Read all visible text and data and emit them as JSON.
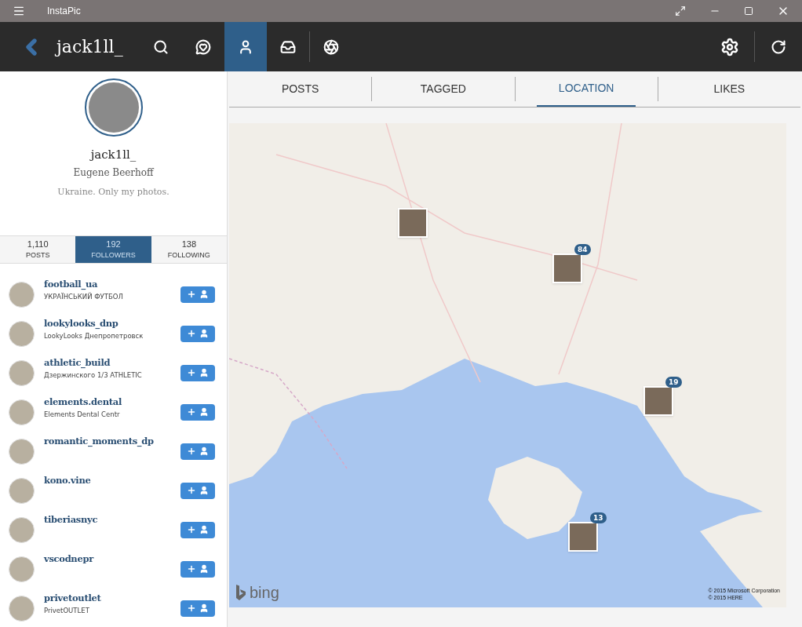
{
  "window": {
    "title": "InstaPic"
  },
  "toolbar": {
    "username": "jack1ll_",
    "nav_items": [
      {
        "kind": "search",
        "selected": false
      },
      {
        "kind": "activity",
        "selected": false
      },
      {
        "kind": "profile",
        "selected": true
      },
      {
        "kind": "inbox",
        "selected": false
      },
      {
        "kind": "camera",
        "selected": false
      }
    ]
  },
  "profile": {
    "username": "jack1ll_",
    "full_name": "Eugene Beerhoff",
    "bio": "Ukraine. Only my photos."
  },
  "stats": [
    {
      "value": "1,110",
      "label": "POSTS",
      "selected": false
    },
    {
      "value": "192",
      "label": "FOLLOWERS",
      "selected": true
    },
    {
      "value": "138",
      "label": "FOLLOWING",
      "selected": false
    }
  ],
  "followers": [
    {
      "username": "football_ua",
      "subtitle": "УКРАЇНСЬКИЙ ФУТБОЛ"
    },
    {
      "username": "lookylooks_dnp",
      "subtitle": "LookyLooks Днепропетровск"
    },
    {
      "username": "athletic_build",
      "subtitle": "Дзержинского 1/3 ATHLETIC"
    },
    {
      "username": "elements.dental",
      "subtitle": "Elements Dental Centr"
    },
    {
      "username": "romantic_moments_dp"
    },
    {
      "username": "kono.vine"
    },
    {
      "username": "tiberiasnyc"
    },
    {
      "username": "vscodnepr"
    },
    {
      "username": "privetoutlet",
      "subtitle": "PrivetOUTLET"
    }
  ],
  "tabs": [
    {
      "label": "POSTS",
      "selected": false
    },
    {
      "label": "TAGGED",
      "selected": false
    },
    {
      "label": "LOCATION",
      "selected": true
    },
    {
      "label": "LIKES",
      "selected": false
    }
  ],
  "map": {
    "pins": [
      {
        "kind": "photo"
      },
      {
        "kind": "photo",
        "count": "84"
      },
      {
        "kind": "photo",
        "count": "19"
      },
      {
        "kind": "photo",
        "count": "13"
      }
    ],
    "logo": "bing",
    "copyright": [
      "© 2015 Microsoft Corporation",
      "© 2015 HERE"
    ]
  }
}
